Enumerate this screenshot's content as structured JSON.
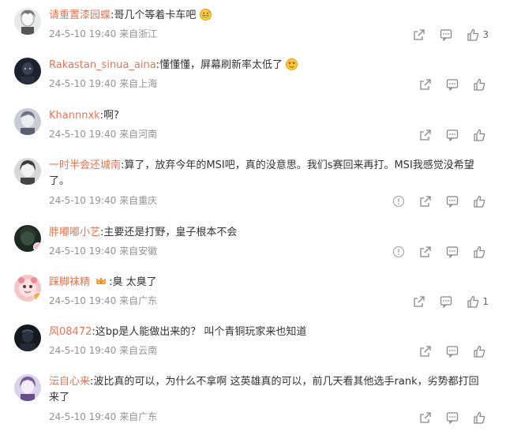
{
  "comments": [
    {
      "username": "请重置漆园蝶",
      "text": ":哥几个等着卡车吧",
      "emoji": "grin-sweat-emoji",
      "time": "24-5-10 19:40",
      "location": "来自浙江",
      "likes": "3"
    },
    {
      "username": "Rakastan_sinua_aina",
      "text": ":懂懂懂，屏幕刷新率太低了",
      "emoji": "heart-eyes-emoji",
      "time": "24-5-10 19:40",
      "location": "来自上海",
      "likes": ""
    },
    {
      "username": "Khannnxk",
      "text": ":啊?",
      "time": "24-5-10 19:40",
      "location": "来自河南",
      "likes": ""
    },
    {
      "username": "一时半会还城南",
      "text": ":算了，放弃今年的MSI吧，真的没意思。我们s赛回来再打。MSI我感觉没希望",
      "text2": "了。",
      "time": "24-5-10 19:40",
      "location": "来自重庆",
      "likes": ""
    },
    {
      "username": "胖嘟嘟小艺",
      "text": ":主要还是打野，皇子根本不会",
      "time": "24-5-10 19:40",
      "location": "来自安徽",
      "likes": ""
    },
    {
      "username": "踩脚袜精",
      "text": ":臭 太臭了",
      "time": "24-5-10 19:40",
      "location": "来自广东",
      "likes": "1"
    },
    {
      "username": "风08472",
      "text": ":这bp是人能做出来的？ 叫个青铜玩家来也知道",
      "time": "24-5-10 19:40",
      "location": "来自云南",
      "likes": ""
    },
    {
      "username": "沄自心来",
      "text": ":波比真的可以，为什么不拿啊 这英雄真的可以，前几天看其他选手rank，劣势都打回",
      "text2": "来了",
      "time": "24-5-10 19:40",
      "location": "来自广东",
      "likes": ""
    }
  ],
  "colors": {
    "username": "#eb7350",
    "meta": "#939393",
    "text": "#333333"
  }
}
